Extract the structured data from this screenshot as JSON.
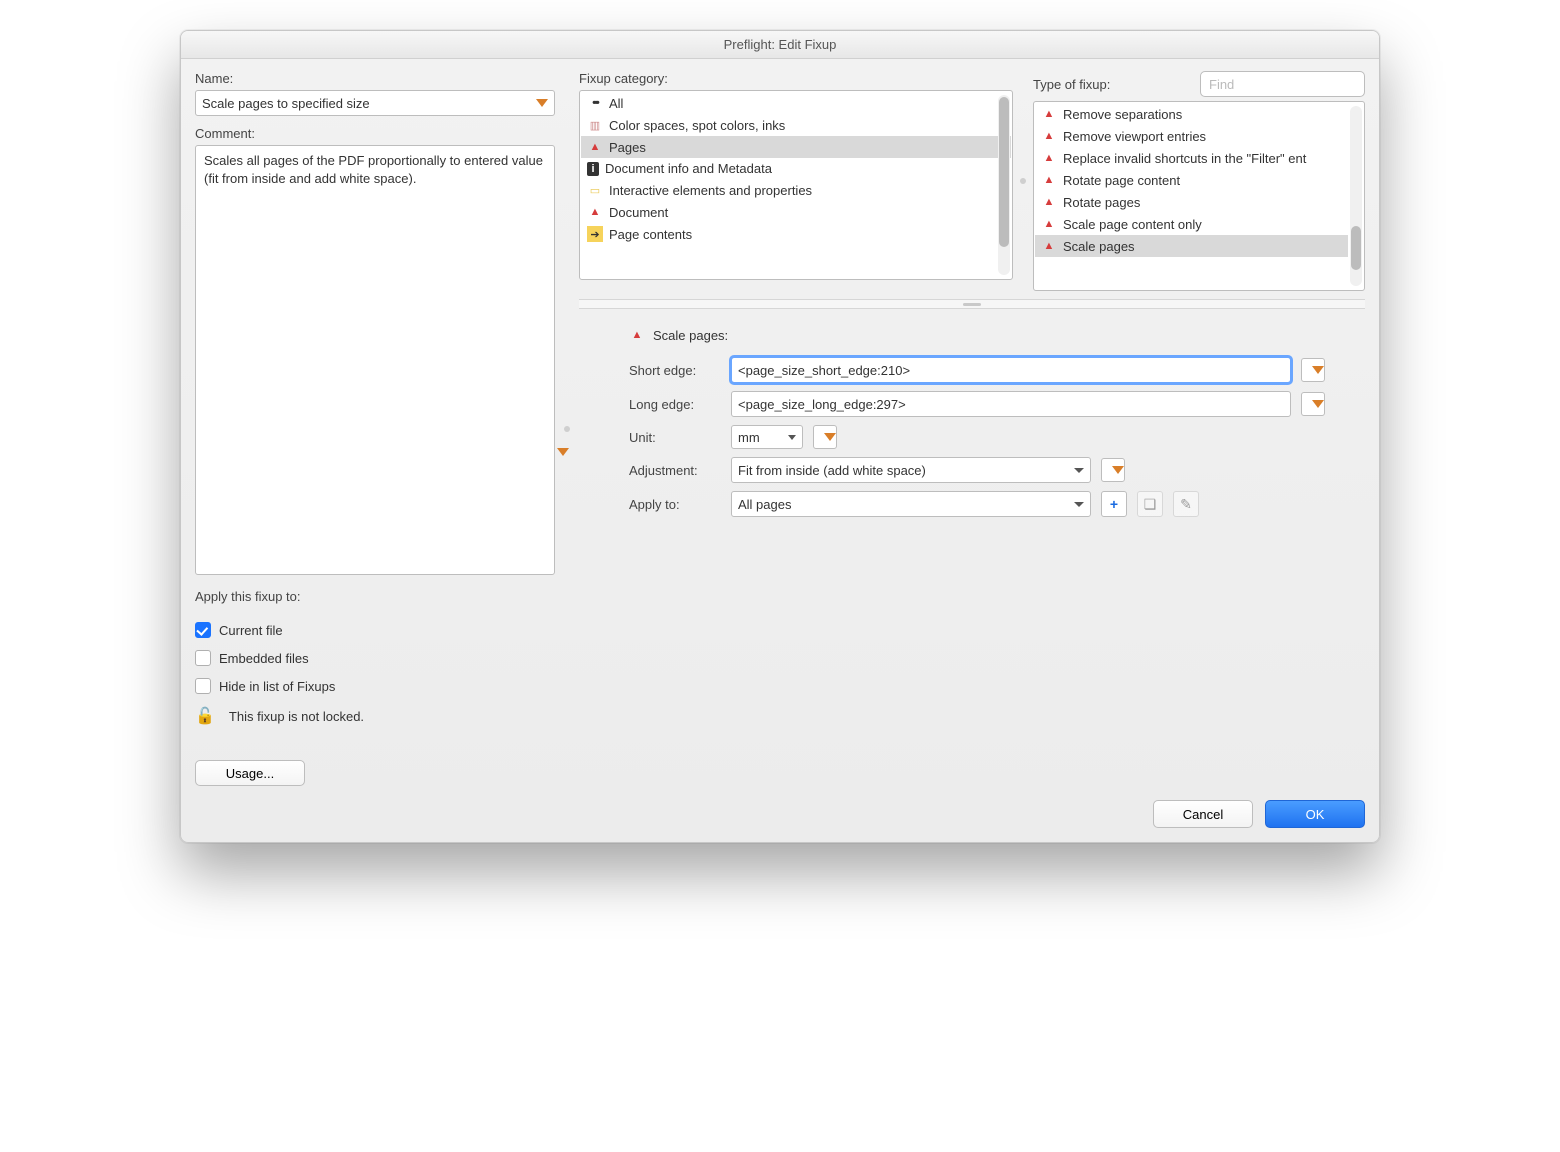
{
  "window": {
    "title": "Preflight: Edit Fixup"
  },
  "left": {
    "name_label": "Name:",
    "name_value": "Scale pages to specified size",
    "comment_label": "Comment:",
    "comment_value": "Scales all pages of the PDF proportionally to entered value (fit from inside and add white space).",
    "apply_label": "Apply this fixup to:",
    "check_current": "Current file",
    "check_embedded": "Embedded files",
    "check_hide": "Hide in list of Fixups",
    "lock_text": "This fixup is not locked.",
    "usage_btn": "Usage..."
  },
  "category": {
    "label": "Fixup category:",
    "items": [
      {
        "icon": "dots",
        "label": "All"
      },
      {
        "icon": "swatch",
        "label": "Color spaces, spot colors, inks"
      },
      {
        "icon": "pdf",
        "label": "Pages",
        "selected": true
      },
      {
        "icon": "info",
        "label": "Document info and Metadata"
      },
      {
        "icon": "note",
        "label": "Interactive elements and properties"
      },
      {
        "icon": "pdf",
        "label": "Document"
      },
      {
        "icon": "arrow",
        "label": "Page contents"
      }
    ]
  },
  "types": {
    "label": "Type of fixup:",
    "find_placeholder": "Find",
    "items": [
      {
        "label": "Remove separations"
      },
      {
        "label": "Remove viewport entries"
      },
      {
        "label": "Replace invalid shortcuts in the \"Filter\" ent"
      },
      {
        "label": "Rotate page content"
      },
      {
        "label": "Rotate pages"
      },
      {
        "label": "Scale page content only"
      },
      {
        "label": "Scale pages",
        "selected": true
      }
    ]
  },
  "form": {
    "title": "Scale pages:",
    "short_label": "Short edge:",
    "short_value": "<page_size_short_edge:210>",
    "long_label": "Long edge:",
    "long_value": "<page_size_long_edge:297>",
    "unit_label": "Unit:",
    "unit_value": "mm",
    "adjust_label": "Adjustment:",
    "adjust_value": "Fit from inside (add white space)",
    "apply_label": "Apply to:",
    "apply_value": "All pages"
  },
  "footer": {
    "cancel": "Cancel",
    "ok": "OK"
  }
}
